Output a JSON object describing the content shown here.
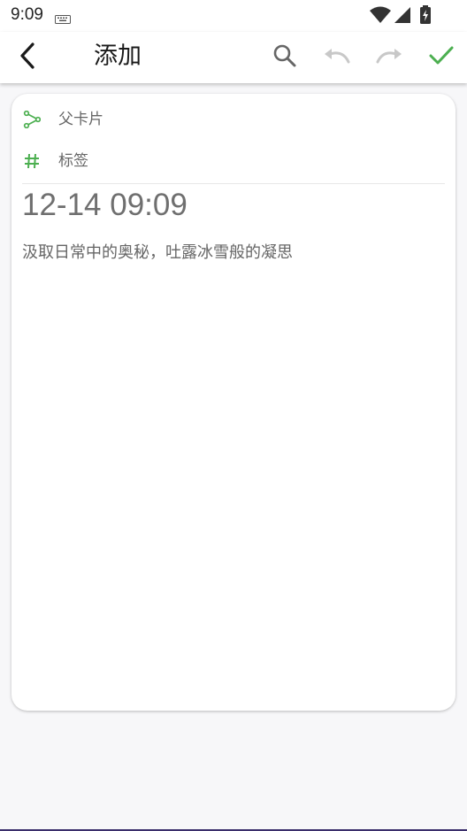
{
  "status_bar": {
    "time": "9:09",
    "icons": [
      "keyboard-icon",
      "wifi-icon",
      "signal-icon",
      "battery-charging-icon"
    ]
  },
  "app_bar": {
    "title": "添加",
    "icons": [
      "back-arrow-icon",
      "search-icon",
      "undo-icon",
      "redo-icon",
      "check-icon"
    ]
  },
  "card": {
    "parent_label": "父卡片",
    "parent_icon": "share-branch-icon",
    "tags_label": "标签",
    "tags_icon": "hash-icon",
    "date": "12-14 09:09",
    "body": "汲取日常中的奥秘，吐露冰雪般的凝思"
  },
  "colors": {
    "accent_green": "#4caf50",
    "disabled_gray": "#c8c8c8",
    "title_text": "#1a1a1a",
    "body_text": "#666666",
    "background": "#f7f7f9"
  }
}
